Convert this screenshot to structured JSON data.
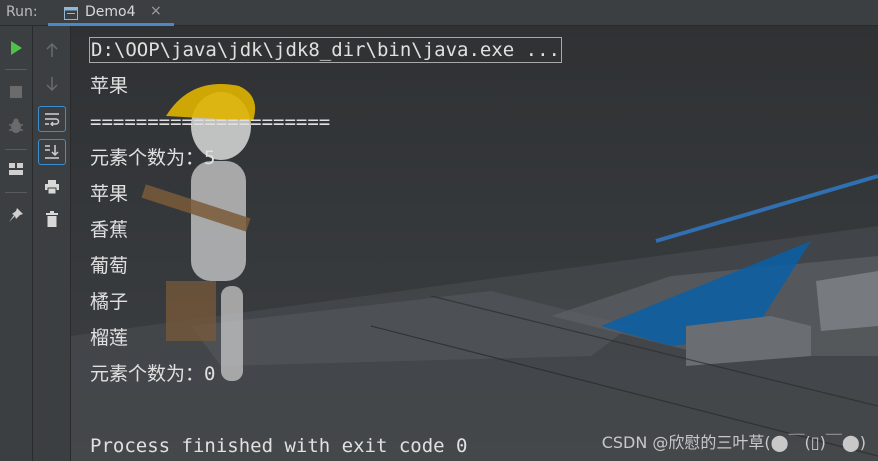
{
  "header": {
    "run_label": "Run:",
    "tab": {
      "label": "Demo4",
      "close_symbol": "×",
      "icon": "console-window-icon"
    }
  },
  "toolbar_left": [
    {
      "name": "rerun-icon",
      "color": "#4cc24a"
    },
    {
      "name": "stop-icon",
      "color": "#6b6b6b"
    },
    {
      "name": "debug-icon",
      "color": "#6b6b6b"
    },
    {
      "name": "layout-icon",
      "color": "#cfcfcf"
    },
    {
      "name": "pin-icon",
      "color": "#cfcfcf"
    }
  ],
  "toolbar_right": [
    {
      "name": "up-arrow-icon"
    },
    {
      "name": "down-arrow-icon"
    },
    {
      "name": "soft-wrap-icon"
    },
    {
      "name": "scroll-to-end-icon"
    },
    {
      "name": "print-icon"
    },
    {
      "name": "trash-icon"
    }
  ],
  "console": {
    "lines": [
      "D:\\OOP\\java\\jdk\\jdk8_dir\\bin\\java.exe ...",
      "苹果",
      "=====================",
      "元素个数为：5",
      "苹果",
      "香蕉",
      "葡萄",
      "橘子",
      "榴莲",
      "元素个数为：0",
      "",
      "Process finished with exit code 0"
    ]
  },
  "watermark": "CSDN @欣慰的三叶草(⬤￣(▯)￣⬤)",
  "colors": {
    "toolbar_bg": "#3c3f41",
    "accent": "#4a88c7",
    "run_green": "#4cc24a",
    "console_text": "#e0e0e0"
  }
}
